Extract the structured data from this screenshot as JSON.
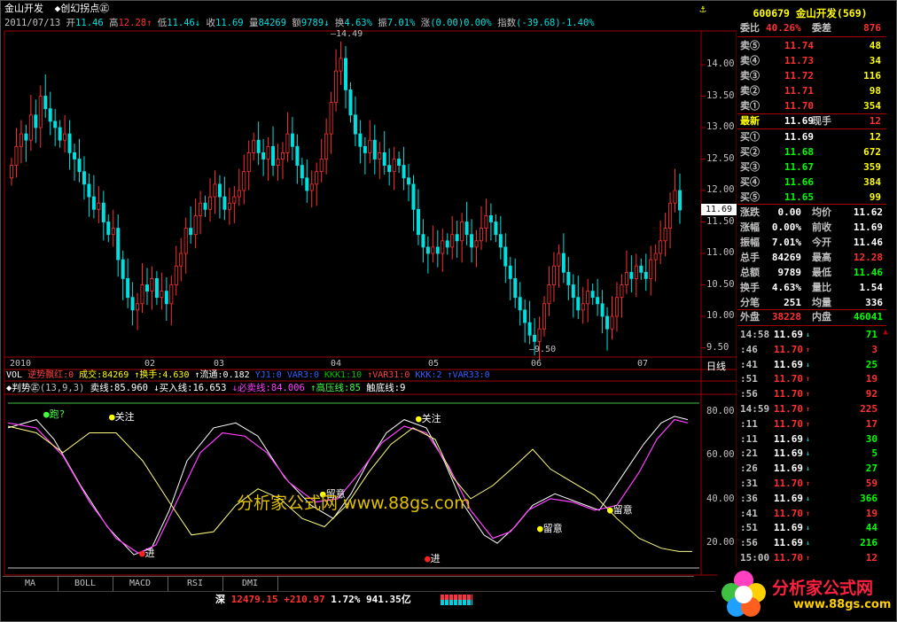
{
  "window": {
    "title": "金山开发",
    "indicator_menu": "◆创幻拐点㊣"
  },
  "price_header": {
    "date": "2011/07/13",
    "open_label": "开",
    "open": "11.46",
    "high_label": "高",
    "high": "12.28",
    "low_label": "低",
    "low": "11.46",
    "close_label": "收",
    "close": "11.69",
    "vol_label": "量",
    "vol": "84269",
    "amt_label": "额",
    "amt": "9789",
    "turn_label": "换",
    "turn": "4.63%",
    "amp_label": "振",
    "amp": "7.01%",
    "chg_label": "涨",
    "chg": "(0.00)0.00%",
    "idx_label": "指数",
    "idx": "(-39.68)-1.40%"
  },
  "price_axis": [
    "14.00",
    "13.50",
    "13.00",
    "12.50",
    "12.00",
    "11.50",
    "11.00",
    "10.50",
    "10.00",
    "9.50"
  ],
  "current_price_tag": "11.69",
  "max_label": "14.49",
  "min_label": "9.50",
  "time_axis": {
    "labels": [
      "2010",
      "02",
      "03",
      "04",
      "05",
      "06",
      "07"
    ],
    "period": "日线"
  },
  "volume_line": {
    "name": "VOL",
    "text1": "逆势飘红:0",
    "text2": "成交:84269",
    "text3": "↑换手:4.630",
    "text4": "↑流通:0.182",
    "text5": "YJ1:0",
    "text6": "VAR3:0",
    "text7": "KKK1:10",
    "text8": "↑VAR31:0",
    "text9": "KKK:2",
    "text10": "↑VAR33:0"
  },
  "indicator": {
    "name": "◆判势㊣",
    "params": "(13,9,3)",
    "sell_line": "卖线:85.960",
    "buy_line": "↓买入线:16.653",
    "must_sell": "↓必卖线:84.006",
    "high_pressure": "↑高压线:85",
    "bottom": "触底线:9",
    "axis": [
      "80.00",
      "60.00",
      "40.00",
      "20.00"
    ],
    "annotations": {
      "run": "跑?",
      "watch1": "关注",
      "watch2": "关注",
      "enter1": "进",
      "enter2": "进",
      "notice1": "留意",
      "notice2": "留意",
      "notice3": "留意"
    }
  },
  "watermark": {
    "text": "分析家公式网 www.88gs.com"
  },
  "tabs": [
    "MA",
    "BOLL",
    "MACD",
    "RSI",
    "DMI"
  ],
  "status": {
    "market": "深",
    "index": "12479.15",
    "change": "+210.97",
    "pct": "1.72%",
    "amount": "941.35亿"
  },
  "quote": {
    "code": "600679",
    "name": "金山开发",
    "num": "(569)",
    "weibi_label": "委比",
    "weibi": "40.26%",
    "weicha_label": "委差",
    "weicha": "876",
    "sells": [
      {
        "label": "卖⑤",
        "price": "11.74",
        "vol": "48"
      },
      {
        "label": "卖④",
        "price": "11.73",
        "vol": "34"
      },
      {
        "label": "卖③",
        "price": "11.72",
        "vol": "116"
      },
      {
        "label": "卖②",
        "price": "11.71",
        "vol": "98"
      },
      {
        "label": "卖①",
        "price": "11.70",
        "vol": "354"
      }
    ],
    "latest_label": "最新",
    "latest": "11.69",
    "now_hand_label": "现手",
    "now_hand": "12",
    "buys": [
      {
        "label": "买①",
        "price": "11.69",
        "vol": "12"
      },
      {
        "label": "买②",
        "price": "11.68",
        "vol": "672"
      },
      {
        "label": "买③",
        "price": "11.67",
        "vol": "359"
      },
      {
        "label": "买④",
        "price": "11.66",
        "vol": "384"
      },
      {
        "label": "买⑤",
        "price": "11.65",
        "vol": "99"
      }
    ],
    "stats": [
      {
        "l1": "涨跌",
        "v1": "0.00",
        "l2": "均价",
        "v2": "11.62"
      },
      {
        "l1": "涨幅",
        "v1": "0.00%",
        "l2": "前收",
        "v2": "11.69"
      },
      {
        "l1": "振幅",
        "v1": "7.01%",
        "l2": "今开",
        "v2": "11.46"
      },
      {
        "l1": "总手",
        "v1": "84269",
        "l2": "最高",
        "v2": "12.28"
      },
      {
        "l1": "总额",
        "v1": "9789",
        "l2": "最低",
        "v2": "11.46"
      },
      {
        "l1": "换手",
        "v1": "4.63%",
        "l2": "量比",
        "v2": "1.54"
      },
      {
        "l1": "分笔",
        "v1": "251",
        "l2": "均量",
        "v2": "336"
      }
    ],
    "outer_label": "外盘",
    "outer": "38228",
    "inner_label": "内盘",
    "inner": "46041",
    "ticks": [
      {
        "t": "14:58",
        "p": "11.69",
        "v": "71",
        "c": "w"
      },
      {
        "t": ":46",
        "p": "11.70",
        "v": "3",
        "c": "r"
      },
      {
        "t": ":41",
        "p": "11.69",
        "v": "25",
        "c": "w"
      },
      {
        "t": ":51",
        "p": "11.70",
        "v": "19",
        "c": "r"
      },
      {
        "t": ":56",
        "p": "11.70",
        "v": "92",
        "c": "r"
      },
      {
        "t": "14:59",
        "p": "11.70",
        "v": "225",
        "c": "r"
      },
      {
        "t": ":11",
        "p": "11.70",
        "v": "17",
        "c": "r"
      },
      {
        "t": ":11",
        "p": "11.69",
        "v": "30",
        "c": "w"
      },
      {
        "t": ":21",
        "p": "11.69",
        "v": "5",
        "c": "w"
      },
      {
        "t": ":26",
        "p": "11.69",
        "v": "27",
        "c": "w"
      },
      {
        "t": ":31",
        "p": "11.70",
        "v": "59",
        "c": "r"
      },
      {
        "t": ":36",
        "p": "11.69",
        "v": "366",
        "c": "w"
      },
      {
        "t": ":41",
        "p": "11.70",
        "v": "19",
        "c": "r"
      },
      {
        "t": ":51",
        "p": "11.69",
        "v": "44",
        "c": "w"
      },
      {
        "t": ":56",
        "p": "11.69",
        "v": "216",
        "c": "w"
      },
      {
        "t": "15:00",
        "p": "11.70",
        "v": "12",
        "c": "r"
      }
    ]
  },
  "logo": {
    "text": "分析家公式网",
    "url": "www.88gs.com"
  },
  "colors": {
    "up": "#ff3030",
    "down": "#00e0e0",
    "border": "#a00000",
    "yellow_line": "#ffff80",
    "white_line": "#ffffff",
    "magenta_line": "#ff40ff"
  }
}
